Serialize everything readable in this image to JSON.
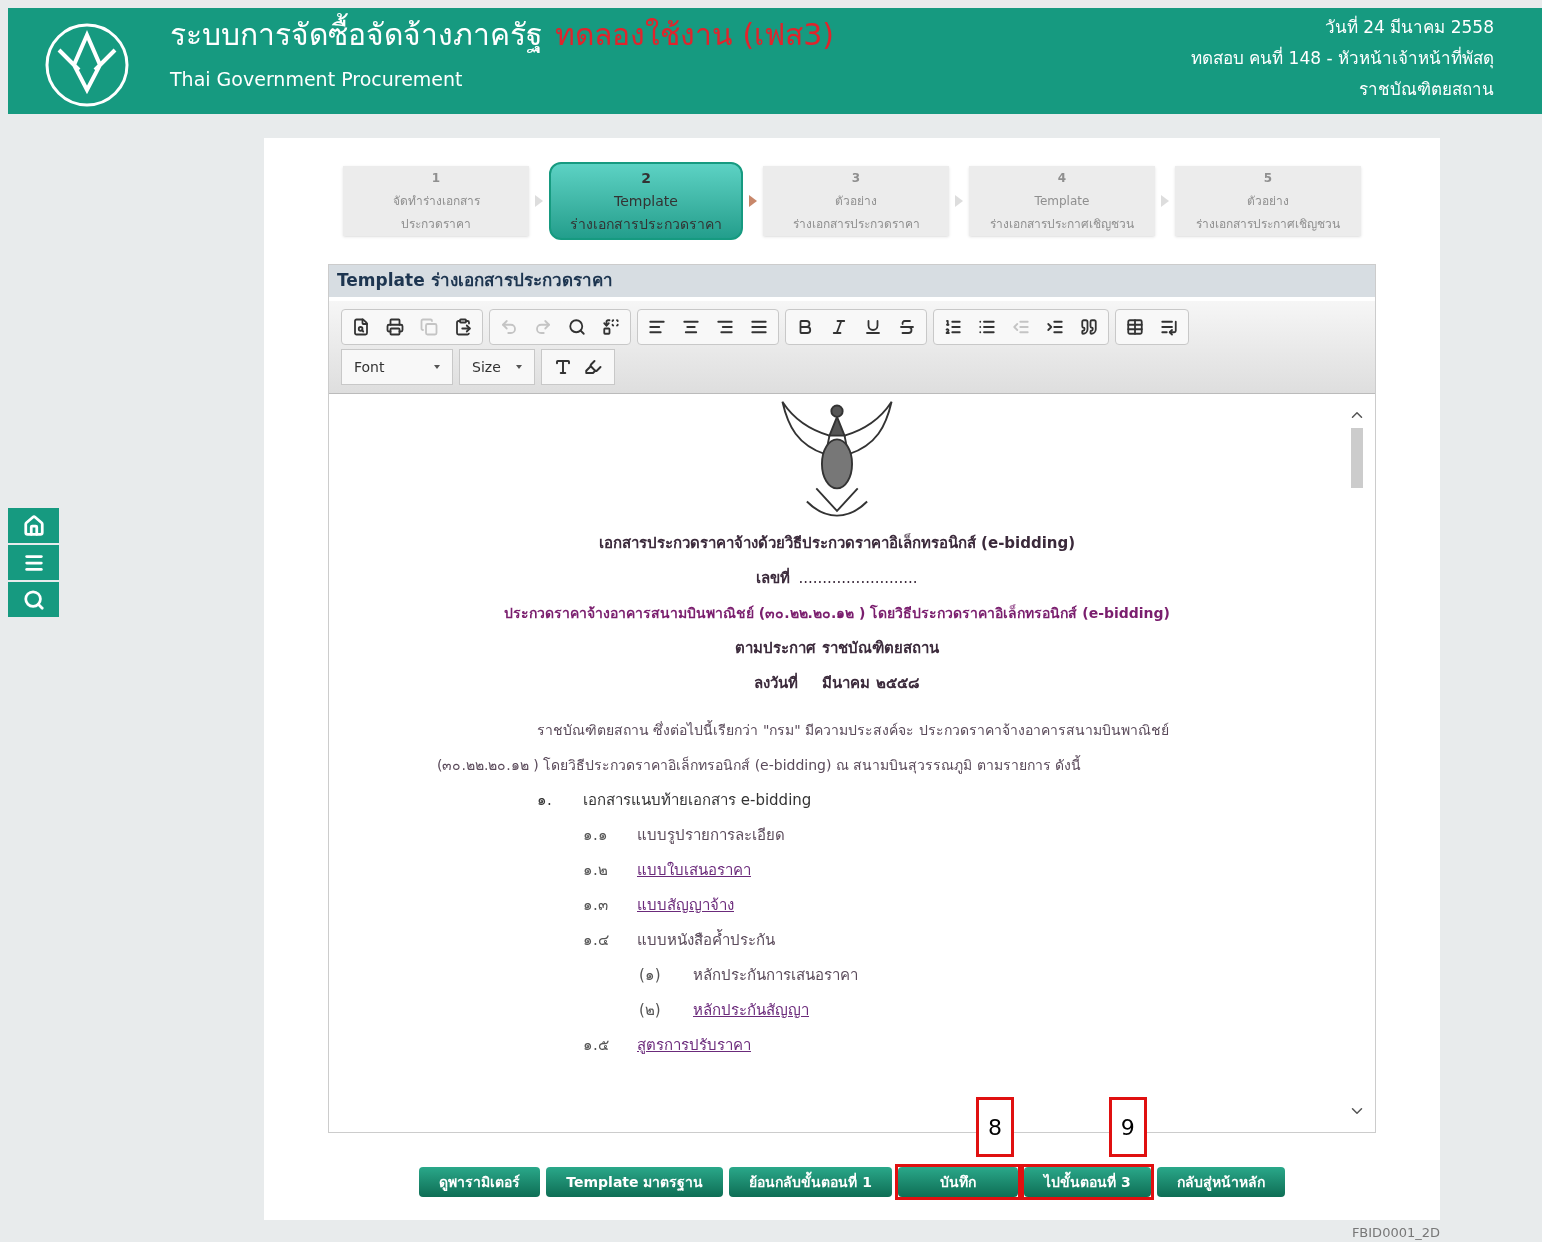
{
  "header": {
    "title": "ระบบการจัดซื้อจัดจ้างภาครัฐ",
    "title_tag": "ทดลองใช้งาน (เฟส3)",
    "subtitle": "Thai Government Procurement",
    "date": "วันที่ 24 มีนาคม 2558",
    "user": "ทดสอบ คนที่ 148 - หัวหน้าเจ้าหน้าที่พัสดุ",
    "org": "ราชบัณฑิตยสถาน"
  },
  "steps": [
    {
      "number": "1",
      "lines": [
        "จัดทำร่างเอกสาร",
        "ประกวดราคา"
      ],
      "selected": false
    },
    {
      "number": "2",
      "lines": [
        "Template",
        "ร่างเอกสารประกวดราคา"
      ],
      "selected": true
    },
    {
      "number": "3",
      "lines": [
        "ตัวอย่าง",
        "ร่างเอกสารประกวดราคา"
      ],
      "selected": false
    },
    {
      "number": "4",
      "lines": [
        "Template",
        "ร่างเอกสารประกาศเชิญชวน"
      ],
      "selected": false
    },
    {
      "number": "5",
      "lines": [
        "ตัวอย่าง",
        "ร่างเอกสารประกาศเชิญชวน"
      ],
      "selected": false
    }
  ],
  "editor": {
    "title": "**Template** ร่างเอกสารประกวดราคา",
    "toolbar_groups": [
      [
        {
          "disabled": false
        },
        {
          "disabled": false
        },
        {
          "disabled": true
        },
        {
          "disabled": false
        }
      ],
      [
        {
          "disabled": true
        },
        {
          "disabled": true
        },
        {
          "disabled": false
        },
        {
          "disabled": false
        }
      ],
      [
        {
          "disabled": false
        },
        {
          "disabled": false
        },
        {
          "disabled": false
        },
        {
          "disabled": false
        }
      ],
      [
        {
          "disabled": false
        },
        {
          "disabled": false
        },
        {
          "disabled": false
        },
        {
          "disabled": false
        }
      ],
      [
        {
          "disabled": false
        },
        {
          "disabled": false
        },
        {
          "disabled": true
        },
        {
          "disabled": false
        },
        {
          "disabled": false
        }
      ],
      [
        {
          "disabled": false
        },
        {
          "disabled": false
        }
      ]
    ],
    "font_select": "Font",
    "size_select": "Size"
  },
  "document": {
    "title": "เอกสารประกวดราคาจ้างด้วยวิธีประกวดราคาอิเล็กทรอนิกส์ (e-bidding)",
    "number_label": "เลขที่",
    "number_blank": ".........................",
    "subject": "ประกวดราคาจ้างอาคารสนามบินพาณิชย์ (๓๐.๒๒.๒๐.๑๒ ) โดยวิธีประกวดราคาอิเล็กทรอนิกส์ (e-bidding)",
    "announcer": "ตามประกาศ ราชบัณฑิตยสถาน",
    "date_label": "ลงวันที่",
    "date_value": "มีนาคม ๒๕๕๘",
    "paragraph": "ราชบัณฑิตยสถาน ซึ่งต่อไปนี้เรียกว่า \"กรม\" มีความประสงค์จะ ประกวดราคาจ้างอาคารสนามบินพาณิชย์ (๓๐.๒๒.๒๐.๑๒ ) โดยวิธีประกวดราคาอิเล็กทรอนิกส์ (e-bidding) ณ สนามบินสุวรรณภูมิ ตามรายการ ดังนี้",
    "sections": [
      {
        "number": "๑.",
        "text": "เอกสารแนบท้ายเอกสาร e-bidding",
        "children": [
          {
            "number": "๑.๑",
            "text": "แบบรูปรายการละเอียด",
            "link": false
          },
          {
            "number": "๑.๒",
            "text": "แบบใบเสนอราคา",
            "link": true
          },
          {
            "number": "๑.๓",
            "text": "แบบสัญญาจ้าง",
            "link": true
          },
          {
            "number": "๑.๔",
            "text": "แบบหนังสือค้ำประกัน",
            "link": false,
            "children": [
              {
                "number": "(๑)",
                "text": "หลักประกันการเสนอราคา",
                "link": false
              },
              {
                "number": "(๒)",
                "text": "หลักประกันสัญญา",
                "link": true
              }
            ]
          },
          {
            "number": "๑.๕",
            "text": "สูตรการปรับราคา",
            "link": true
          }
        ]
      }
    ]
  },
  "buttons": [
    {
      "label": "ดูพารามิเตอร์"
    },
    {
      "label": "Template มาตรฐาน"
    },
    {
      "label": "ย้อนกลับขั้นตอนที่ 1"
    },
    {
      "label": "บันทึก",
      "callout": "8"
    },
    {
      "label": "ไปขั้นตอนที่ 3",
      "callout": "9"
    },
    {
      "label": "กลับสู่หน้าหลัก"
    }
  ],
  "page_code": "FBID0001_2D"
}
